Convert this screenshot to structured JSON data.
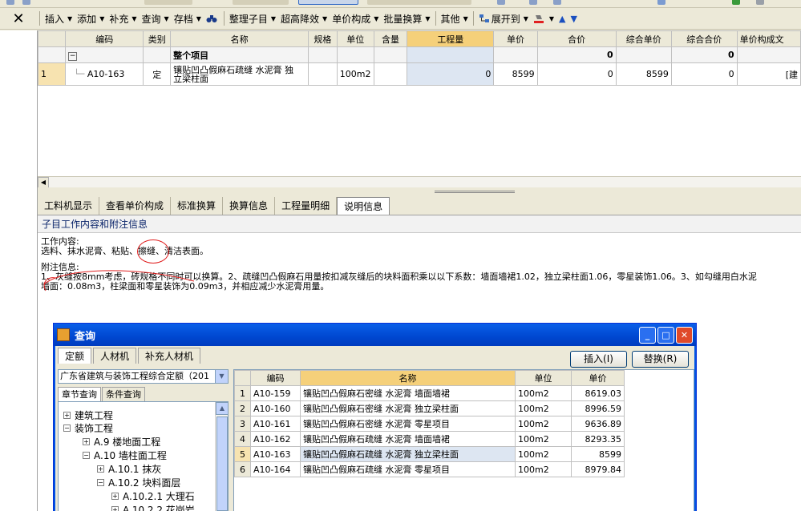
{
  "toolbar": {
    "close_glyph": "✕",
    "items": [
      {
        "label": "插入",
        "caret": true
      },
      {
        "label": "添加",
        "caret": true
      },
      {
        "label": "补充",
        "caret": true
      },
      {
        "label": "查询",
        "caret": true
      },
      {
        "label": "存档",
        "caret": true
      },
      {
        "label": "整理子目",
        "caret": true
      },
      {
        "label": "超高降效",
        "caret": true
      },
      {
        "label": "单价构成",
        "caret": true
      },
      {
        "label": "批量换算",
        "caret": true
      },
      {
        "label": "其他",
        "caret": true
      },
      {
        "label": "展开到",
        "caret": true
      }
    ]
  },
  "grid": {
    "columns": [
      "",
      "编码",
      "类别",
      "名称",
      "规格",
      "单位",
      "含量",
      "工程量",
      "单价",
      "合价",
      "综合单价",
      "综合合价",
      "单价构成文"
    ],
    "summary_row": {
      "expander": "−",
      "name": "整个项目",
      "hejia": "0",
      "zonghe_hejia": "0"
    },
    "rows": [
      {
        "no": "1",
        "code": "A10-163",
        "type": "定",
        "name_line1": "镶贴凹凸假麻石疏缝 水泥膏 独",
        "name_line2": "立梁柱面",
        "spec": "",
        "unit": "100m2",
        "content": "",
        "qty": "0",
        "price": "8599",
        "total": "0",
        "unit_total": "8599",
        "grand_total": "0",
        "composition": "[建"
      }
    ]
  },
  "tabs": [
    "工料机显示",
    "查看单价构成",
    "标准换算",
    "换算信息",
    "工程量明细",
    "说明信息"
  ],
  "info": {
    "header": "子目工作内容和附注信息",
    "work_title": "工作内容:",
    "work_text": "选料、抹水泥膏、粘贴、擦缝、清洁表面。",
    "note_title": "附注信息:",
    "note_line1": "1、灰缝按8mm考虑，砖规格不同时可以换算。2、疏缝凹凸假麻石用量按扣减灰缝后的块料面积乘以以下系数：墙面墙裙1.02，独立梁柱面1.06，零星装饰1.06。3、如勾缝用白水泥",
    "note_line2": "墙面：0.08m3，柱梁面和零星装饰为0.09m3，并相应减少水泥膏用量。"
  },
  "dialog": {
    "title": "查询",
    "tabs": [
      "定额",
      "人材机",
      "补充人材机"
    ],
    "insert_label": "插入(I)",
    "replace_label": "替换(R)",
    "select_value": "广东省建筑与装饰工程综合定额（201",
    "subtabs": [
      "章节查询",
      "条件查询"
    ],
    "tree": [
      {
        "label": "建筑工程",
        "sign": "+",
        "level": 0
      },
      {
        "label": "装饰工程",
        "sign": "−",
        "level": 0
      },
      {
        "label": "A.9 楼地面工程",
        "sign": "+",
        "level": 1
      },
      {
        "label": "A.10 墙柱面工程",
        "sign": "−",
        "level": 1
      },
      {
        "label": "A.10.1 抹灰",
        "sign": "+",
        "level": 2
      },
      {
        "label": "A.10.2 块料面层",
        "sign": "−",
        "level": 2
      },
      {
        "label": "A.10.2.1 大理石",
        "sign": "+",
        "level": 3
      },
      {
        "label": "A.10.2.2 花岗岩",
        "sign": "+",
        "level": 3
      }
    ],
    "result_columns": [
      "",
      "编码",
      "名称",
      "单位",
      "单价"
    ],
    "results": [
      {
        "no": "1",
        "code": "A10-159",
        "name": "镶贴凹凸假麻石密缝 水泥膏 墙面墙裙",
        "unit": "100m2",
        "price": "8619.03"
      },
      {
        "no": "2",
        "code": "A10-160",
        "name": "镶贴凹凸假麻石密缝 水泥膏 独立梁柱面",
        "unit": "100m2",
        "price": "8996.59"
      },
      {
        "no": "3",
        "code": "A10-161",
        "name": "镶贴凹凸假麻石密缝 水泥膏 零星项目",
        "unit": "100m2",
        "price": "9636.89"
      },
      {
        "no": "4",
        "code": "A10-162",
        "name": "镶贴凹凸假麻石疏缝 水泥膏 墙面墙裙",
        "unit": "100m2",
        "price": "8293.35"
      },
      {
        "no": "5",
        "code": "A10-163",
        "name": "镶贴凹凸假麻石疏缝 水泥膏 独立梁柱面",
        "unit": "100m2",
        "price": "8599"
      },
      {
        "no": "6",
        "code": "A10-164",
        "name": "镶贴凹凸假麻石疏缝 水泥膏 零星项目",
        "unit": "100m2",
        "price": "8979.84"
      }
    ]
  },
  "colors": {
    "header_highlight": "#f5d07a",
    "selected_cell": "#dde6f2",
    "title_bar": "#0054e3",
    "annotation_red": "#e02020"
  }
}
